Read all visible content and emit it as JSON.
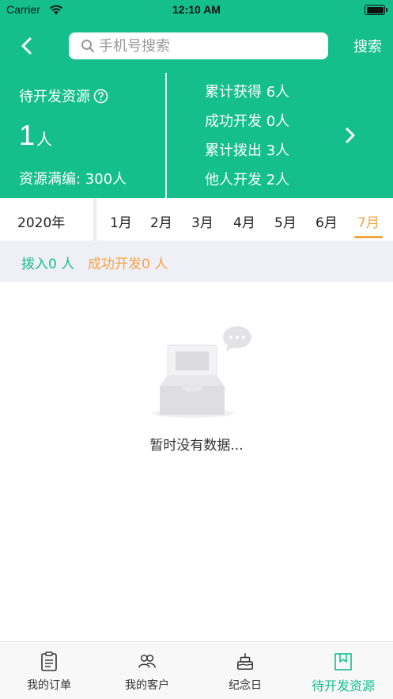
{
  "status_bar": {
    "carrier": "Carrier",
    "time": "12:10 AM"
  },
  "nav": {
    "search_placeholder": "手机号搜索",
    "search_label": "搜索"
  },
  "stats": {
    "title": "待开发资源",
    "count": "1",
    "count_unit": "人",
    "capacity": "资源满编: 300人",
    "items": [
      "累计获得 6人",
      "成功开发 0人",
      "累计拨出 3人",
      "他人开发 2人"
    ]
  },
  "months": {
    "year": "2020年",
    "items": [
      "1月",
      "2月",
      "3月",
      "4月",
      "5月",
      "6月",
      "7月"
    ],
    "active_index": 6
  },
  "summary": {
    "in": "拨入0 人",
    "dev": "成功开发0 人"
  },
  "empty": {
    "text": "暂时没有数据..."
  },
  "tabbar": {
    "items": [
      "我的订单",
      "我的客户",
      "纪念日",
      "待开发资源"
    ],
    "active_index": 3
  },
  "colors": {
    "primary": "#14bf8c",
    "accent": "#f5a444",
    "summary_bg": "#efeff7"
  }
}
